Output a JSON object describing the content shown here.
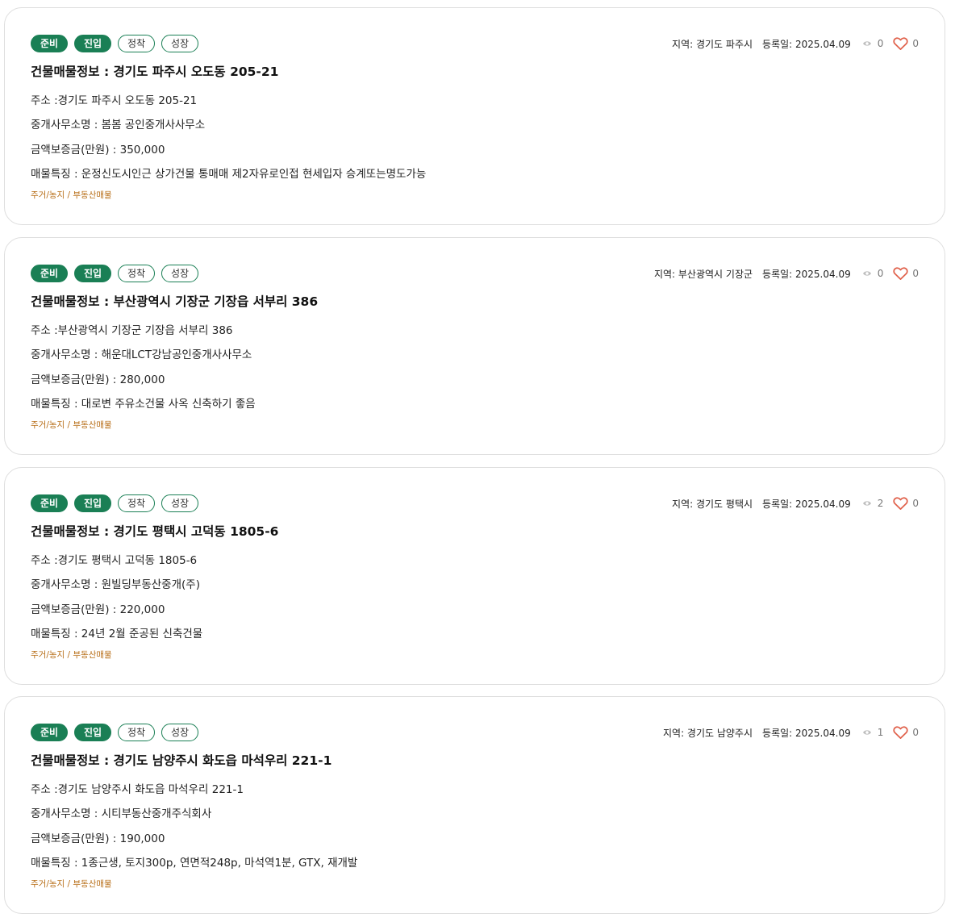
{
  "listings": [
    {
      "tags": [
        "준비",
        "진입",
        "정착",
        "성장"
      ],
      "region": "지역: 경기도 파주시",
      "date": "등록일: 2025.04.09",
      "views": "0",
      "likes": "0",
      "title": "건물매물정보 : 경기도 파주시 오도동 205-21",
      "address": "주소 :경기도 파주시 오도동 205-21",
      "broker": "중개사무소명 : 봄봄 공인중개사사무소",
      "deposit": "금액보증금(만원) : 350,000",
      "feature": "매물특징 : 운정신도시인근 상가건물 통매매 제2자유로인접 현세입자 승계또는명도가능",
      "category": "주거/농지 / 부동산매물"
    },
    {
      "tags": [
        "준비",
        "진입",
        "정착",
        "성장"
      ],
      "region": "지역: 부산광역시 기장군",
      "date": "등록일: 2025.04.09",
      "views": "0",
      "likes": "0",
      "title": "건물매물정보 : 부산광역시 기장군 기장읍 서부리 386",
      "address": "주소 :부산광역시 기장군 기장읍 서부리 386",
      "broker": "중개사무소명 : 해운대LCT강남공인중개사사무소",
      "deposit": "금액보증금(만원) : 280,000",
      "feature": "매물특징 : 대로변 주유소건물 사옥 신축하기 좋음",
      "category": "주거/농지 / 부동산매물"
    },
    {
      "tags": [
        "준비",
        "진입",
        "정착",
        "성장"
      ],
      "region": "지역: 경기도 평택시",
      "date": "등록일: 2025.04.09",
      "views": "2",
      "likes": "0",
      "title": "건물매물정보 : 경기도 평택시 고덕동 1805-6",
      "address": "주소 :경기도 평택시 고덕동 1805-6",
      "broker": "중개사무소명 : 원빌딩부동산중개(주)",
      "deposit": "금액보증금(만원) : 220,000",
      "feature": "매물특징 : 24년 2월 준공된 신축건물",
      "category": "주거/농지 / 부동산매물"
    },
    {
      "tags": [
        "준비",
        "진입",
        "정착",
        "성장"
      ],
      "region": "지역: 경기도 남양주시",
      "date": "등록일: 2025.04.09",
      "views": "1",
      "likes": "0",
      "title": "건물매물정보 : 경기도 남양주시 화도읍 마석우리 221-1",
      "address": "주소 :경기도 남양주시 화도읍 마석우리 221-1",
      "broker": "중개사무소명 : 시티부동산중개주식회사",
      "deposit": "금액보증금(만원) : 190,000",
      "feature": "매물특징 : 1종근생, 토지300p, 연면적248p, 마석역1분, GTX, 재개발",
      "category": "주거/농지 / 부동산매물"
    }
  ],
  "colors": {
    "tag_green": "#1a7f55",
    "heart": "#e0604a",
    "category": "#b86f1a"
  },
  "icons": {
    "views": "eye-icon",
    "likes": "heart-icon"
  }
}
